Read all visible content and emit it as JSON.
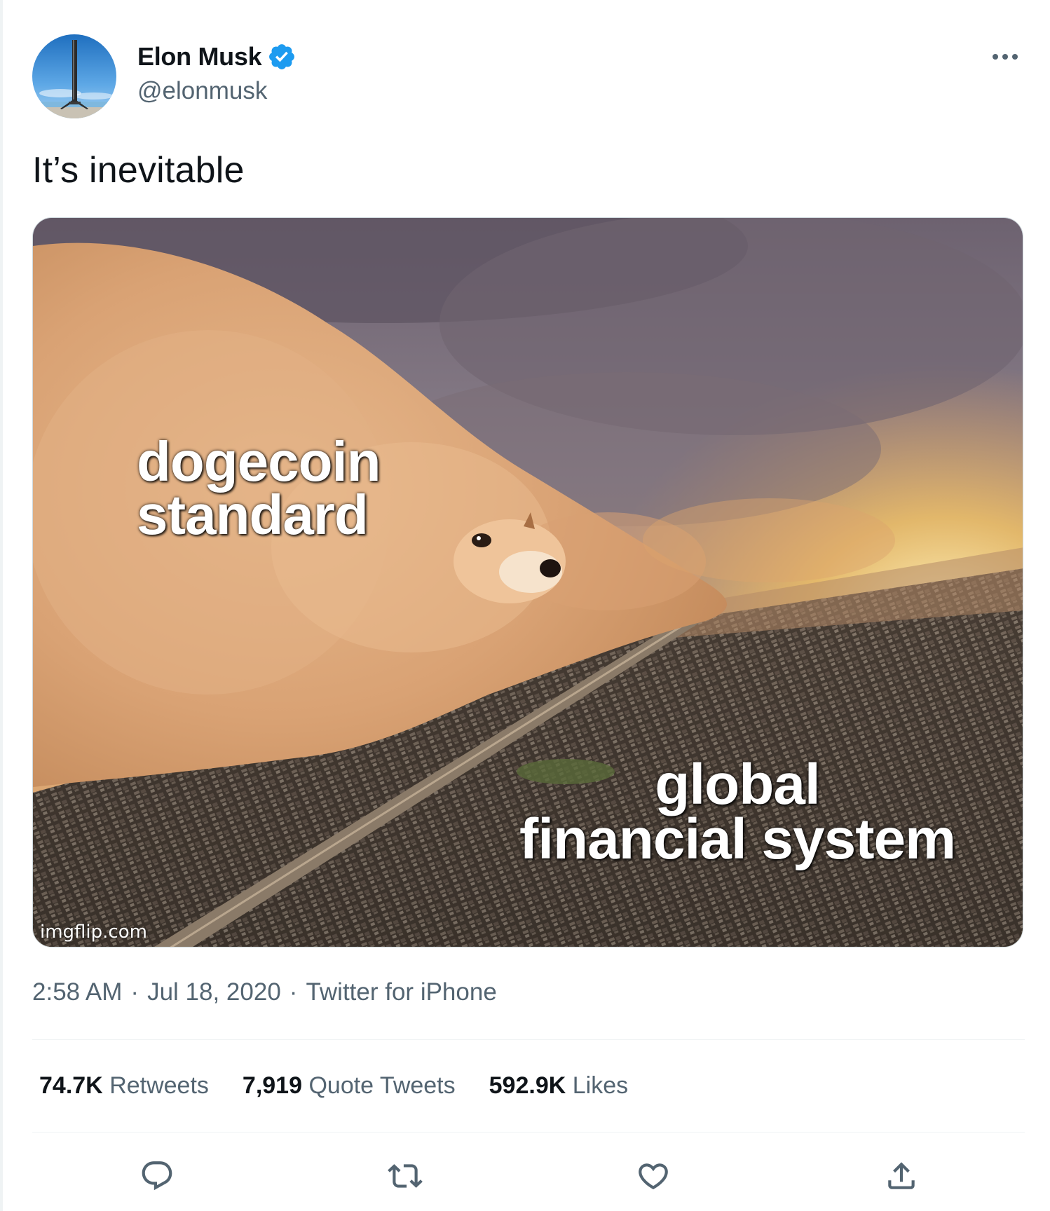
{
  "author": {
    "name": "Elon Musk",
    "handle": "@elonmusk",
    "verified": true,
    "avatar_icon": "rocket-launch-avatar",
    "verified_icon": "verified-badge-icon",
    "verified_color": "#1d9bf0"
  },
  "more_icon": "more-dots-icon",
  "tweet": {
    "text": "It’s inevitable"
  },
  "media": {
    "top_label_line1": "dogecoin",
    "top_label_line2": "standard",
    "bottom_label_line1": "global",
    "bottom_label_line2": "financial system",
    "watermark": "imgflip.com"
  },
  "meta": {
    "time": "2:58 AM",
    "separator": "·",
    "date": "Jul 18, 2020",
    "source": "Twitter for iPhone"
  },
  "stats": {
    "retweets_count": "74.7K",
    "retweets_label": "Retweets",
    "quotes_count": "7,919",
    "quotes_label": "Quote Tweets",
    "likes_count": "592.9K",
    "likes_label": "Likes"
  },
  "actions": {
    "reply_icon": "reply-icon",
    "retweet_icon": "retweet-icon",
    "like_icon": "heart-icon",
    "share_icon": "share-icon",
    "icon_color": "#536471"
  },
  "colors": {
    "text_primary": "#0f1419",
    "text_secondary": "#536471",
    "divider": "#eff3f4"
  }
}
